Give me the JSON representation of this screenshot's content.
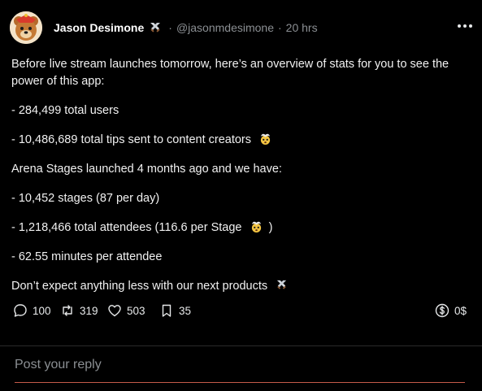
{
  "post": {
    "author_name": "Jason Desimone",
    "handle": "@jasonmdesimone",
    "separator": "·",
    "time": "20 hrs",
    "avatar_icon": "bear-avatar",
    "body": {
      "intro": "Before live stream launches tomorrow, here’s an overview of stats for you to see the power of this app:",
      "stat_users": "- 284,499 total users",
      "stat_tips": "- 10,486,689 total tips sent to content creators",
      "arena_intro": "Arena Stages launched 4 months ago and we have:",
      "stat_stages": "- 10,452 stages (87 per day)",
      "stat_attendees_prefix": "- 1,218,466 total attendees (116.6 per Stage",
      "stat_attendees_suffix": ")",
      "stat_minutes": "- 62.55 minutes per attendee",
      "closing": "Don’t expect anything less with our next products"
    },
    "actions": {
      "replies": "100",
      "reposts": "319",
      "likes": "503",
      "bookmarks": "35",
      "tips": "0$"
    }
  },
  "reply_input": {
    "placeholder": "Post your reply"
  },
  "colors": {
    "background": "#000000",
    "text": "#e7e9ea",
    "muted": "#8b8f93",
    "input_underline": "#c55b4a"
  }
}
